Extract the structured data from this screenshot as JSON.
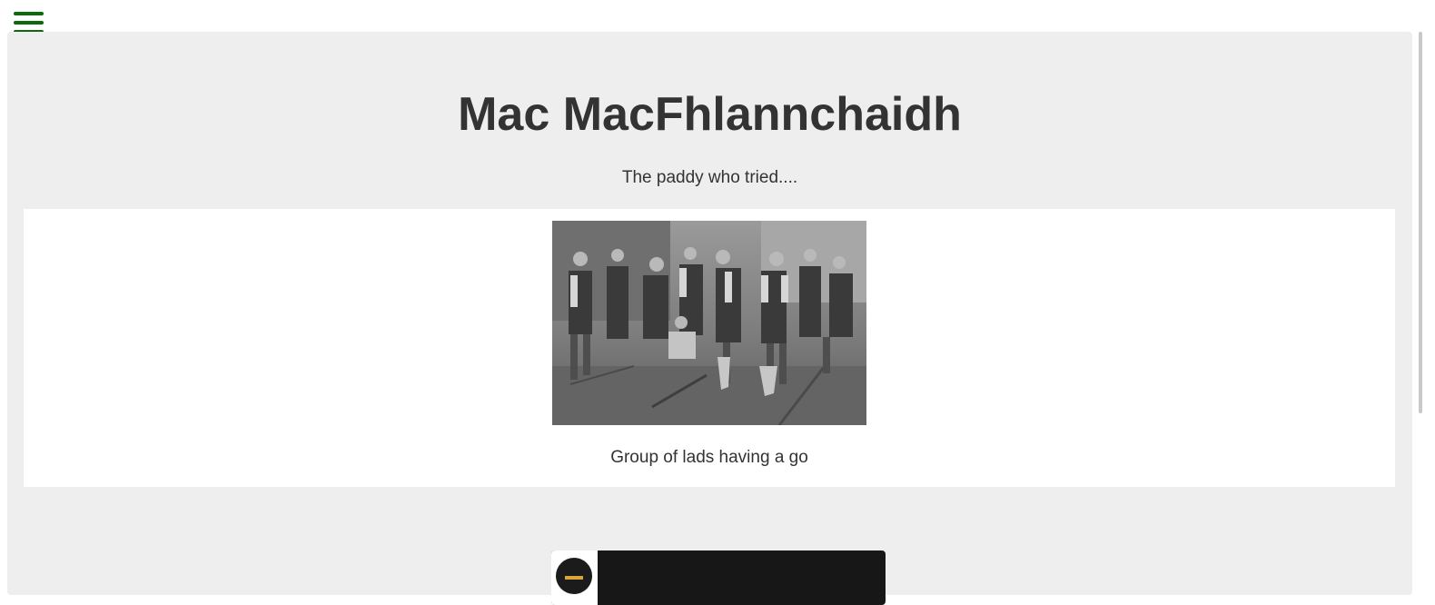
{
  "nav": {
    "menu_icon": "hamburger-menu-icon",
    "accent_color": "#0a6b0a"
  },
  "hero": {
    "title": "Mac MacFhlannchaidh",
    "subtitle": "The paddy who tried....",
    "background_color": "#eeeeee"
  },
  "feature": {
    "image_caption": "Group of lads having a go"
  },
  "player": {
    "background_color": "#171717"
  }
}
